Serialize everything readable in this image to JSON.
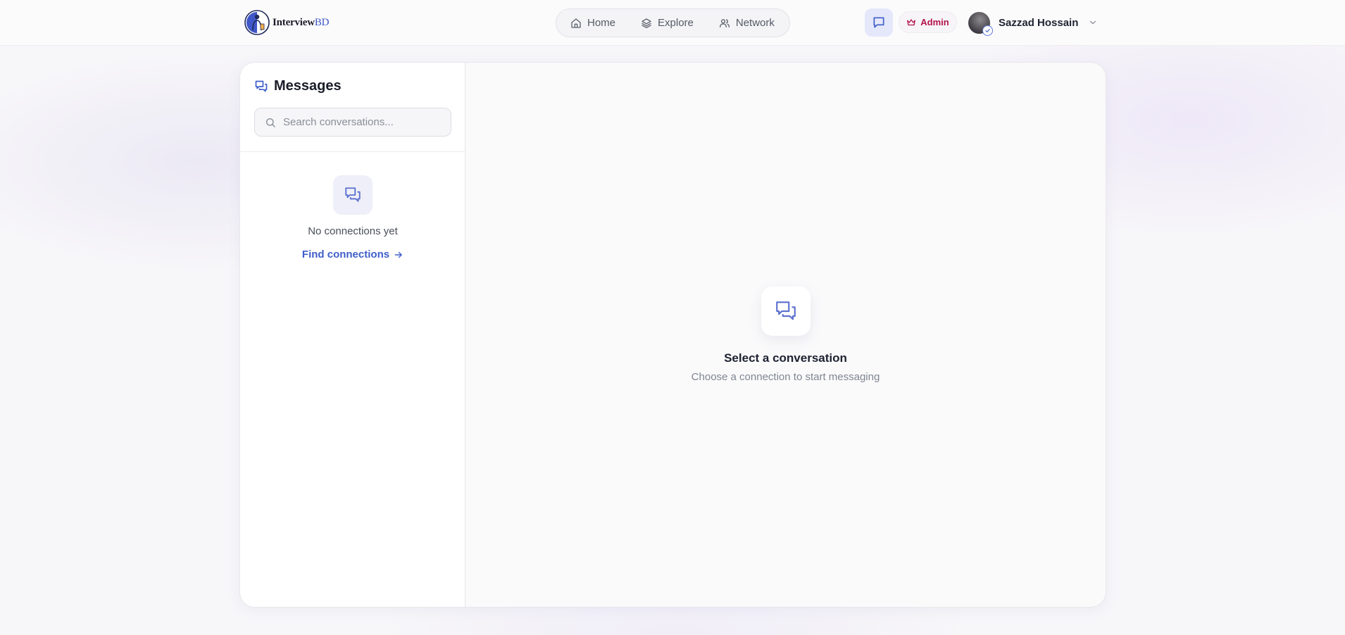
{
  "header": {
    "logo": {
      "name": "Interview",
      "suffix": "BD"
    },
    "nav": [
      {
        "label": "Home",
        "icon": "home-icon"
      },
      {
        "label": "Explore",
        "icon": "layers-icon"
      },
      {
        "label": "Network",
        "icon": "users-icon"
      }
    ],
    "messages_icon": "chat-icon",
    "admin_label": "Admin",
    "user_name": "Sazzad Hossain"
  },
  "sidebar": {
    "title": "Messages",
    "search_placeholder": "Search conversations...",
    "empty_text": "No connections yet",
    "find_link": "Find connections"
  },
  "main": {
    "empty_title": "Select a conversation",
    "empty_subtitle": "Choose a connection to start messaging"
  },
  "colors": {
    "accent": "#3e5ec9",
    "admin": "#b2144a",
    "page_bg": "#f7f6f9"
  }
}
